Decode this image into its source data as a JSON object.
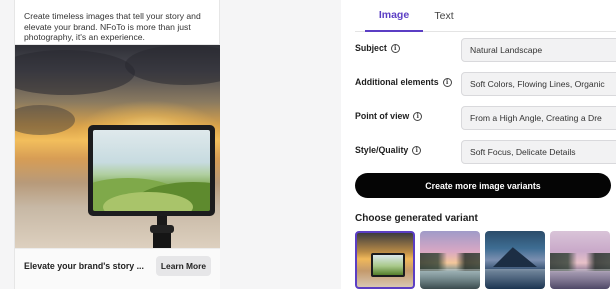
{
  "ad_preview": {
    "description_lines": [
      "Create timeless images that tell your story and",
      "elevate your brand. NFoTo is more than just",
      "photography, it's an experience."
    ],
    "footer_title": "Elevate your brand's story ...",
    "cta_label": "Learn More"
  },
  "tabs": [
    {
      "label": "Image",
      "active": true
    },
    {
      "label": "Text",
      "active": false
    }
  ],
  "fields": [
    {
      "label": "Subject",
      "value": "Natural Landscape"
    },
    {
      "label": "Additional elements",
      "value": "Soft Colors, Flowing Lines, Organic"
    },
    {
      "label": "Point of view",
      "value": "From a High Angle, Creating a Dre"
    },
    {
      "label": "Style/Quality",
      "value": "Soft Focus, Delicate Details"
    }
  ],
  "create_button_label": "Create more image variants",
  "variants_section_title": "Choose generated variant",
  "variants": [
    {
      "name": "variant-1",
      "selected": true
    },
    {
      "name": "variant-2",
      "selected": false
    },
    {
      "name": "variant-3",
      "selected": false
    },
    {
      "name": "variant-4",
      "selected": false
    }
  ],
  "colors": {
    "accent": "#5b3ec4",
    "cta_background": "#050505",
    "input_background": "#f2f2f3"
  },
  "icons": {
    "info": "info-icon"
  }
}
